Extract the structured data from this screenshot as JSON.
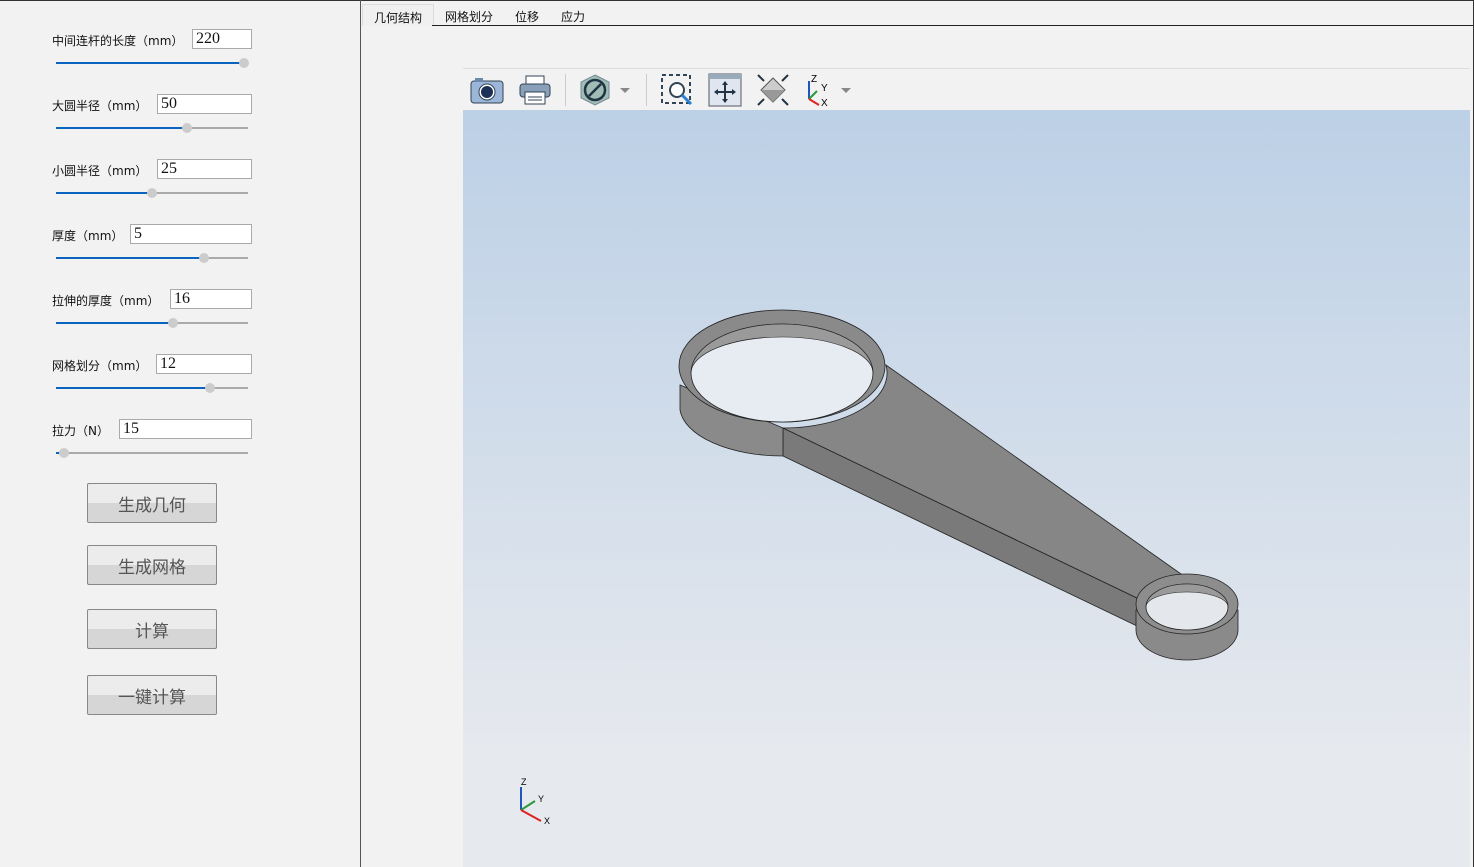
{
  "params": [
    {
      "label": "中间连杆的长度（mm）",
      "value": "220",
      "slider": 0.98
    },
    {
      "label": "大圆半径（mm）",
      "value": "50",
      "slider": 0.68
    },
    {
      "label": "小圆半径（mm）",
      "value": "25",
      "slider": 0.5
    },
    {
      "label": "厚度（mm）",
      "value": "5",
      "slider": 0.77
    },
    {
      "label": "拉伸的厚度（mm）",
      "value": "16",
      "slider": 0.61
    },
    {
      "label": "网格划分（mm）",
      "value": "12",
      "slider": 0.8
    },
    {
      "label": "拉力（N）",
      "value": "15",
      "slider": 0.04
    }
  ],
  "buttons": [
    "生成几何",
    "生成网格",
    "计算",
    "一键计算"
  ],
  "tabs": [
    "几何结构",
    "网格划分",
    "位移",
    "应力"
  ],
  "active_tab": 0,
  "toolbar": [
    "camera-icon",
    "printer-icon",
    "display-mode-icon",
    "zoom-window-icon",
    "pan-icon",
    "fit-all-icon",
    "axes-view-icon"
  ],
  "axis_labels": {
    "z": "Z",
    "y": "Y",
    "x": "X"
  },
  "colors": {
    "slider_fill": "#0a64c0",
    "model": "#858585",
    "bg_top": "#bcd0e6",
    "bg_bottom": "#e6e9ee"
  }
}
